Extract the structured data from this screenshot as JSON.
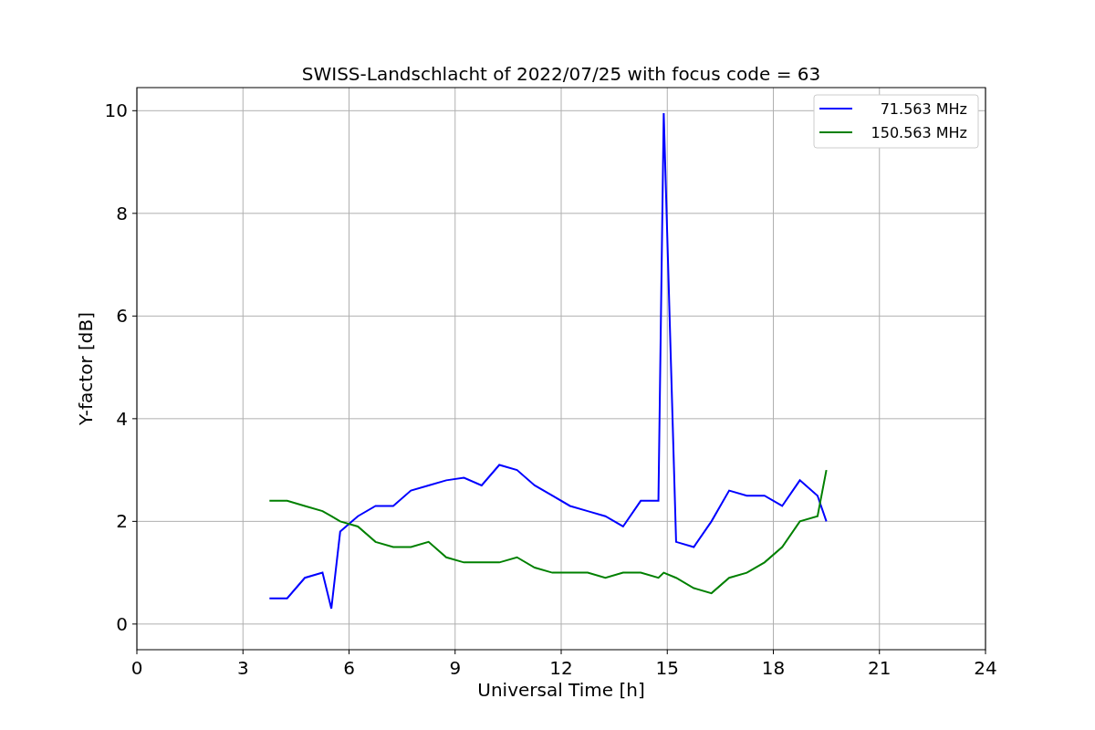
{
  "figure": {
    "chart_data": {
      "type": "line",
      "title": "SWISS-Landschlacht of 2022/07/25 with focus code = 63",
      "xlabel": "Universal Time [h]",
      "ylabel": "Y-factor [dB]",
      "x": [
        3.75,
        4.25,
        4.75,
        5.25,
        5.5,
        5.75,
        6.25,
        6.75,
        7.25,
        7.75,
        8.25,
        8.75,
        9.25,
        9.75,
        10.25,
        10.75,
        11.25,
        11.75,
        12.25,
        12.75,
        13.25,
        13.75,
        14.25,
        14.75,
        14.9,
        15.25,
        15.75,
        16.25,
        16.75,
        17.25,
        17.75,
        18.25,
        18.75,
        19.25,
        19.5
      ],
      "series": [
        {
          "name": "71.563 MHz",
          "color": "#0000ff",
          "values": [
            0.5,
            0.5,
            0.9,
            1.0,
            0.3,
            1.8,
            2.1,
            2.3,
            2.3,
            2.6,
            2.7,
            2.8,
            2.85,
            2.7,
            3.1,
            3.0,
            2.7,
            2.5,
            2.3,
            2.2,
            2.1,
            1.9,
            2.4,
            2.4,
            9.95,
            1.6,
            1.5,
            2.0,
            2.6,
            2.5,
            2.5,
            2.3,
            2.8,
            2.5,
            2.0
          ]
        },
        {
          "name": "150.563 MHz",
          "color": "#008000",
          "values": [
            2.4,
            2.4,
            2.3,
            2.2,
            2.1,
            2.0,
            1.9,
            1.6,
            1.5,
            1.5,
            1.6,
            1.3,
            1.2,
            1.2,
            1.2,
            1.3,
            1.1,
            1.0,
            1.0,
            1.0,
            0.9,
            1.0,
            1.0,
            0.9,
            1.0,
            0.9,
            0.7,
            0.6,
            0.9,
            1.0,
            1.2,
            1.5,
            2.0,
            2.1,
            3.0
          ]
        }
      ],
      "grid": true,
      "legend": true,
      "xlim": [
        0,
        24
      ],
      "ylim": [
        -0.5,
        10.45
      ],
      "xticks": [
        0,
        3,
        6,
        9,
        12,
        15,
        18,
        21,
        24
      ],
      "yticks": [
        0,
        2,
        4,
        6,
        8,
        10
      ]
    }
  }
}
